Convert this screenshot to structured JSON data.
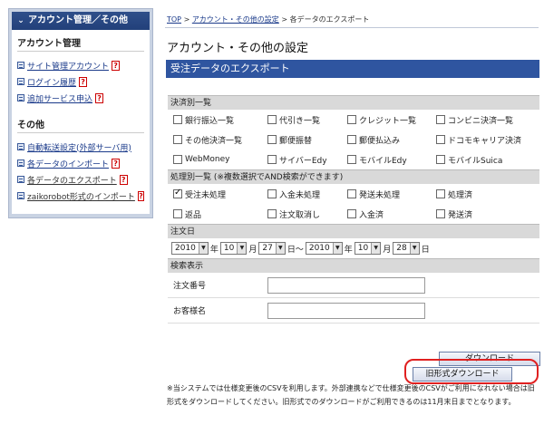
{
  "sidebar": {
    "header": "アカウント管理／その他",
    "sections": [
      {
        "title": "アカウント管理",
        "items": [
          {
            "label": "サイト管理アカウント",
            "help": "?"
          },
          {
            "label": "ログイン履歴",
            "help": "?"
          },
          {
            "label": "追加サービス申込",
            "help": "?"
          }
        ]
      },
      {
        "title": "その他",
        "items": [
          {
            "label": "自動転送設定(外部サーバ用)",
            "help": ""
          },
          {
            "label": "各データのインポート",
            "help": "?"
          },
          {
            "label": "各データのエクスポート",
            "help": "?"
          },
          {
            "label": "zaikorobot形式のインポート",
            "help": "?"
          }
        ]
      }
    ]
  },
  "breadcrumb": {
    "top": "TOP",
    "sep1": ">",
    "parent": "アカウント・その他の設定",
    "sep2": ">",
    "current": "各データのエクスポート"
  },
  "page_title": "アカウント・その他の設定",
  "section_title": "受注データのエクスポート",
  "payment": {
    "heading": "決済別一覧",
    "options": [
      {
        "label": "銀行振込一覧",
        "checked": false
      },
      {
        "label": "代引き一覧",
        "checked": false
      },
      {
        "label": "クレジット一覧",
        "checked": false
      },
      {
        "label": "コンビニ決済一覧",
        "checked": false
      },
      {
        "label": "その他決済一覧",
        "checked": false
      },
      {
        "label": "郵便振替",
        "checked": false
      },
      {
        "label": "郵便払込み",
        "checked": false
      },
      {
        "label": "ドコモキャリア決済",
        "checked": false
      },
      {
        "label": "WebMoney",
        "checked": false
      },
      {
        "label": "サイバーEdy",
        "checked": false
      },
      {
        "label": "モバイルEdy",
        "checked": false
      },
      {
        "label": "モバイルSuica",
        "checked": false
      }
    ]
  },
  "process": {
    "heading": "処理別一覧 (※複数選択でAND検索ができます)",
    "options": [
      {
        "label": "受注未処理",
        "checked": true
      },
      {
        "label": "入金未処理",
        "checked": false
      },
      {
        "label": "発送未処理",
        "checked": false
      },
      {
        "label": "処理済",
        "checked": false
      },
      {
        "label": "返品",
        "checked": false
      },
      {
        "label": "注文取消し",
        "checked": false
      },
      {
        "label": "入金済",
        "checked": false
      },
      {
        "label": "発送済",
        "checked": false
      }
    ]
  },
  "order_date": {
    "heading": "注文日",
    "from": {
      "year": "2010",
      "month": "10",
      "day": "27"
    },
    "to": {
      "year": "2010",
      "month": "10",
      "day": "28"
    },
    "unit_year": "年",
    "unit_month": "月",
    "unit_day": "日",
    "range_sep": "日〜"
  },
  "search": {
    "heading": "検索表示",
    "order_number_label": "注文番号",
    "customer_name_label": "お客様名",
    "order_number_value": "",
    "customer_name_value": ""
  },
  "buttons": {
    "download": "ダウンロード",
    "old_download": "旧形式ダウンロード"
  },
  "note": "※当システムでは仕様変更後のCSVを利用します。外部連携などで仕様変更後のCSVがご利用になれない場合は旧形式をダウンロードしてください。旧形式でのダウンロードがご利用できるのは11月末日までとなります。"
}
